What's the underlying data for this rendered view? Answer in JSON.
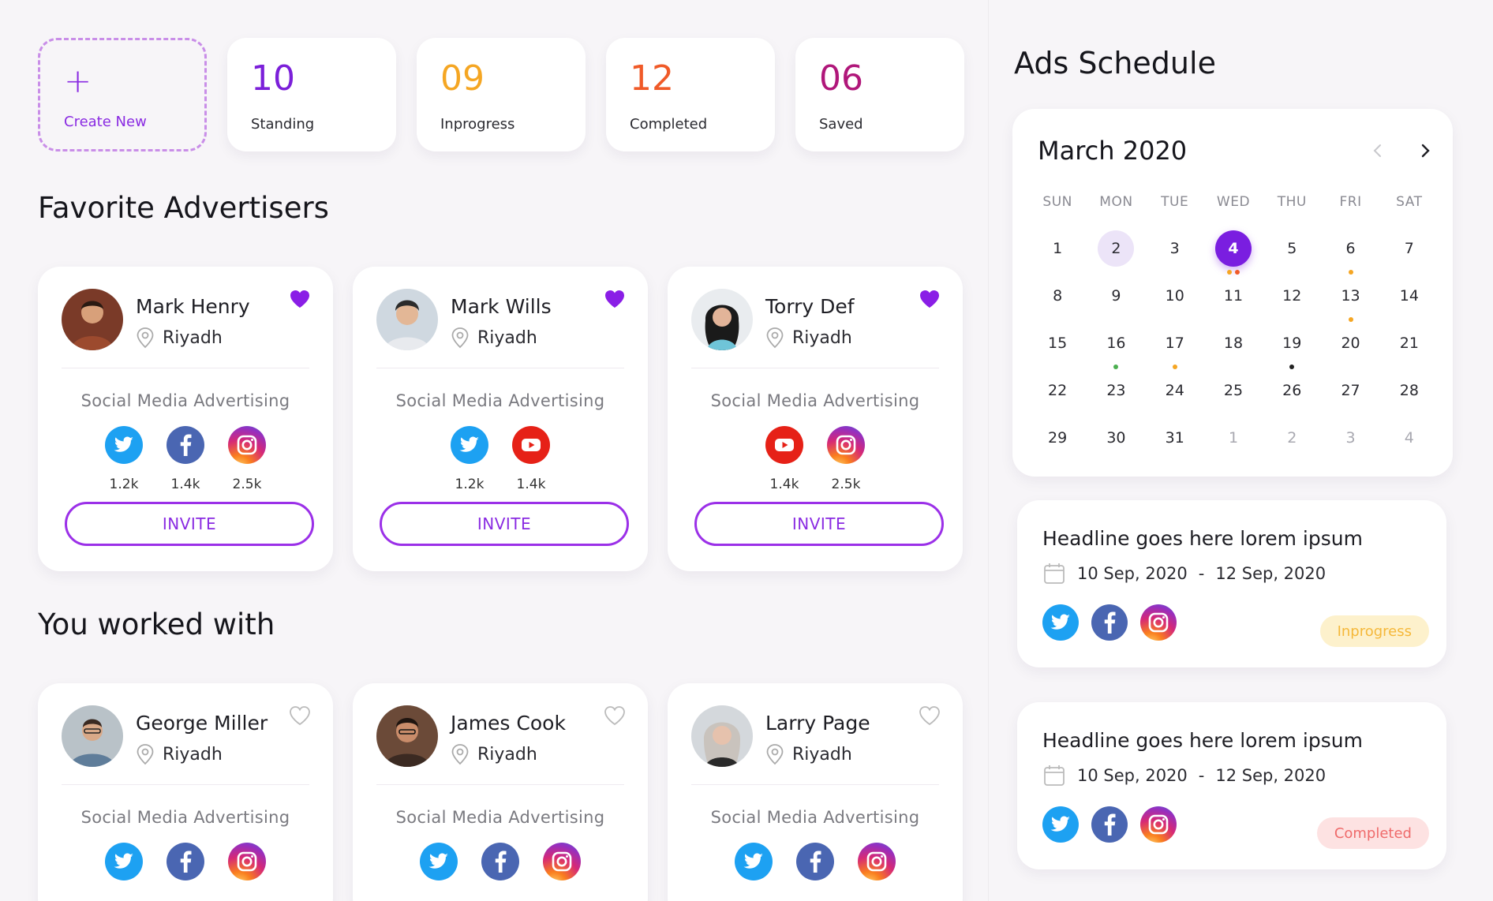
{
  "stats": [
    {
      "value": "10",
      "label": "Standing",
      "color": "#7b1fd9"
    },
    {
      "value": "09",
      "label": "Inprogress",
      "color": "#f5a623"
    },
    {
      "value": "12",
      "label": "Completed",
      "color": "#f05a28"
    },
    {
      "value": "06",
      "label": "Saved",
      "color": "#b0177a"
    }
  ],
  "create_new": {
    "icon": "+",
    "label": "Create New"
  },
  "favorites": {
    "title": "Favorite Advertisers",
    "cards": [
      {
        "name": "Mark Henry",
        "location": "Riyadh",
        "type": "Social Media Advertising",
        "favorited": true,
        "socials": [
          {
            "icon": "twitter-icon",
            "count": "1.2k"
          },
          {
            "icon": "facebook-icon",
            "count": "1.4k"
          },
          {
            "icon": "instagram-icon",
            "count": "2.5k"
          }
        ],
        "button": "INVITE"
      },
      {
        "name": "Mark Wills",
        "location": "Riyadh",
        "type": "Social Media Advertising",
        "favorited": true,
        "socials": [
          {
            "icon": "twitter-icon",
            "count": "1.2k"
          },
          {
            "icon": "youtube-icon",
            "count": "1.4k"
          }
        ],
        "button": "INVITE"
      },
      {
        "name": "Torry Def",
        "location": "Riyadh",
        "type": "Social Media Advertising",
        "favorited": true,
        "socials": [
          {
            "icon": "youtube-icon",
            "count": "1.4k"
          },
          {
            "icon": "instagram-icon",
            "count": "2.5k"
          }
        ],
        "button": "INVITE"
      }
    ]
  },
  "worked_with": {
    "title": "You worked with",
    "cards": [
      {
        "name": "George Miller",
        "location": "Riyadh",
        "type": "Social Media Advertising",
        "favorited": false,
        "socials": [
          {
            "icon": "twitter-icon"
          },
          {
            "icon": "facebook-icon"
          },
          {
            "icon": "instagram-icon"
          }
        ]
      },
      {
        "name": "James Cook",
        "location": "Riyadh",
        "type": "Social Media Advertising",
        "favorited": false,
        "socials": [
          {
            "icon": "twitter-icon"
          },
          {
            "icon": "facebook-icon"
          },
          {
            "icon": "instagram-icon"
          }
        ]
      },
      {
        "name": "Larry Page",
        "location": "Riyadh",
        "type": "Social Media Advertising",
        "favorited": false,
        "socials": [
          {
            "icon": "twitter-icon"
          },
          {
            "icon": "facebook-icon"
          },
          {
            "icon": "instagram-icon"
          }
        ]
      }
    ]
  },
  "ads_schedule": {
    "title": "Ads Schedule",
    "calendar": {
      "month": "March 2020",
      "weekdays": [
        "SUN",
        "MON",
        "TUE",
        "WED",
        "THU",
        "FRI",
        "SAT"
      ],
      "weeks": [
        [
          "1",
          "2",
          "3",
          "4",
          "5",
          "6",
          "7"
        ],
        [
          "8",
          "9",
          "10",
          "11",
          "12",
          "13",
          "14"
        ],
        [
          "15",
          "16",
          "17",
          "18",
          "19",
          "20",
          "21"
        ],
        [
          "22",
          "23",
          "24",
          "25",
          "26",
          "27",
          "28"
        ],
        [
          "29",
          "30",
          "31",
          "1",
          "2",
          "3",
          "4"
        ]
      ],
      "selected_day": "4",
      "highlighted_day": "2",
      "markers": {
        "4": [
          "#f5a623",
          "#f05a28"
        ],
        "6": [
          "#f5a623"
        ],
        "13": [
          "#f5a623"
        ],
        "16": [
          "#4caf50"
        ],
        "17": [
          "#f5a623"
        ],
        "19": [
          "#222222"
        ]
      }
    },
    "events": [
      {
        "title": "Headline goes here lorem ipsum",
        "date_from": "10 Sep, 2020",
        "date_sep": "-",
        "date_to": "12 Sep, 2020",
        "status": "Inprogress",
        "status_bg": "#fdf1cc",
        "status_color": "#f5b83a"
      },
      {
        "title": "Headline goes here lorem ipsum",
        "date_from": "10 Sep, 2020",
        "date_sep": "-",
        "date_to": "12 Sep, 2020",
        "status": "Completed",
        "status_bg": "#fde2e2",
        "status_color": "#ef6b6b"
      }
    ]
  }
}
